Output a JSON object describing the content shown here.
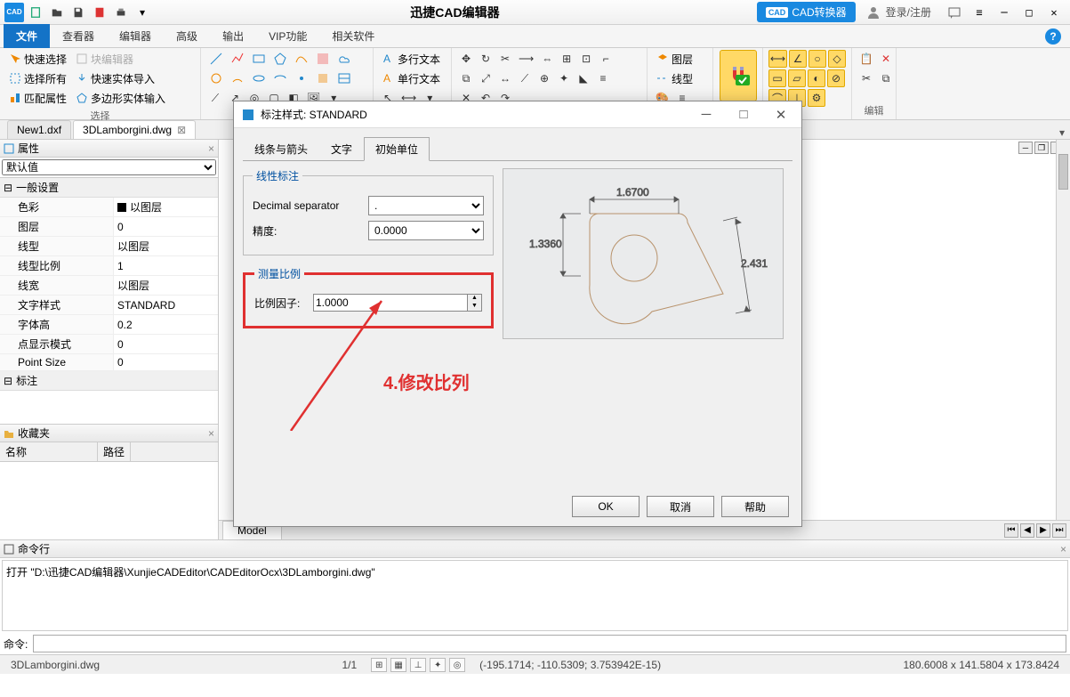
{
  "app_title": "迅捷CAD编辑器",
  "cad_convert_label": "CAD转换器",
  "cad_convert_icon": "CAD",
  "login_label": "登录/注册",
  "menu": {
    "items": [
      "文件",
      "查看器",
      "编辑器",
      "高级",
      "输出",
      "VIP功能",
      "相关软件"
    ],
    "active": 0
  },
  "toolbar": {
    "select_group_label": "选择",
    "quick_select": "快速选择",
    "block_editor": "块编辑器",
    "select_all": "选择所有",
    "quick_entity_import": "快速实体导入",
    "match_props": "匹配属性",
    "polygon_entity_input": "多边形实体输入",
    "multiline_text": "多行文本",
    "single_text": "单行文本",
    "layer": "图层",
    "linetype": "线型",
    "snap_label": "捕捉",
    "edit_label": "编辑"
  },
  "file_tabs": {
    "tabs": [
      "New1.dxf",
      "3DLamborgini.dwg"
    ],
    "active": 1
  },
  "properties_panel": {
    "title": "属性",
    "default_value": "默认值",
    "section_general": "一般设置",
    "section_annotation": "标注",
    "rows": [
      {
        "key": "色彩",
        "val": "以图层",
        "swatch": true
      },
      {
        "key": "图层",
        "val": "0"
      },
      {
        "key": "线型",
        "val": "以图层"
      },
      {
        "key": "线型比例",
        "val": "1"
      },
      {
        "key": "线宽",
        "val": "以图层"
      },
      {
        "key": "文字样式",
        "val": "STANDARD"
      },
      {
        "key": "字体高",
        "val": "0.2"
      },
      {
        "key": "点显示模式",
        "val": "0"
      },
      {
        "key": "Point Size",
        "val": "0"
      }
    ]
  },
  "favorites_panel": {
    "title": "收藏夹",
    "col_name": "名称",
    "col_path": "路径"
  },
  "modal": {
    "title": "标注样式: STANDARD",
    "tabs": [
      "线条与箭头",
      "文字",
      "初始单位"
    ],
    "active_tab": 2,
    "linear_legend": "线性标注",
    "decimal_sep_label": "Decimal separator",
    "decimal_sep_value": ".",
    "precision_label": "精度:",
    "precision_value": "0.0000",
    "scale_legend": "测量比例",
    "scale_factor_label": "比例因子:",
    "scale_factor_value": "1.0000",
    "preview_dims": {
      "top": "1.6700",
      "left": "1.3360",
      "right": "2.4315"
    },
    "ok": "OK",
    "cancel": "取消",
    "help": "帮助"
  },
  "annotation_text": "4.修改比列",
  "model_tab": "Model",
  "command_panel": {
    "title": "命令行",
    "log_line": "打开 \"D:\\迅捷CAD编辑器\\XunjieCADEditor\\CADEditorOcx\\3DLamborgini.dwg\"",
    "prompt": "命令:"
  },
  "status": {
    "file": "3DLamborgini.dwg",
    "pages": "1/1",
    "coords": "(-195.1714; -110.5309; 3.753942E-15)",
    "dims": "180.6008 x 141.5804 x 173.8424"
  }
}
